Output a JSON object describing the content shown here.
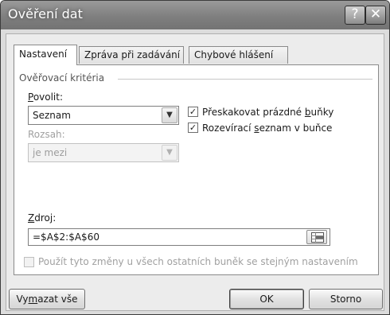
{
  "window": {
    "title": "Ověření dat",
    "help_glyph": "?",
    "close_glyph": "✕"
  },
  "tabs": [
    {
      "label": "Nastavení",
      "active": true
    },
    {
      "label": "Zpráva při zadávání",
      "active": false
    },
    {
      "label": "Chybové hlášení",
      "active": false
    }
  ],
  "criteria": {
    "group_label": "Ověřovací kritéria",
    "allow": {
      "label_u": "P",
      "label_rest": "ovolit:",
      "value": "Seznam"
    },
    "data": {
      "label": "Rozsah:",
      "value": "je mezi",
      "disabled": true
    },
    "ignore_blank": {
      "label_pre": "Přeskakovat prázdné ",
      "label_u": "b",
      "label_post": "uňky",
      "checked": true
    },
    "in_cell_dropdown": {
      "label_pre": "Rozevírací ",
      "label_u": "s",
      "label_post": "eznam v buňce",
      "checked": true
    }
  },
  "source": {
    "label_u": "Z",
    "label_rest": "droj:",
    "value": "=$A$2:$A$60"
  },
  "apply_all": {
    "label": "Použít tyto změny u všech ostatních buněk se stejným nastavením",
    "checked": false,
    "disabled": true
  },
  "buttons": {
    "clear_pre": "Vy",
    "clear_u": "m",
    "clear_post": "azat vše",
    "ok": "OK",
    "cancel": "Storno"
  },
  "check_glyph": "✓",
  "dropdown_glyph": "▼",
  "colors": {
    "titlebar": "#808080",
    "dialog_bg": "#ececec",
    "panel_bg": "#ffffff"
  }
}
